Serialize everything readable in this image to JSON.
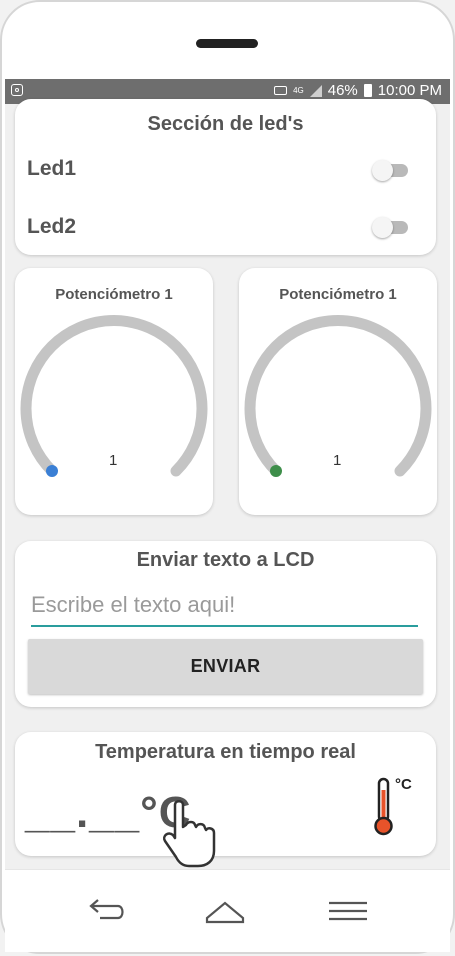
{
  "status_bar": {
    "network": "4G",
    "battery": "46%",
    "time": "10:00 PM"
  },
  "led_section": {
    "title": "Sección de led's",
    "leds": [
      {
        "label": "Led1",
        "on": false
      },
      {
        "label": "Led2",
        "on": false
      }
    ]
  },
  "potentiometers": [
    {
      "title": "Potenciómetro 1",
      "value": "1",
      "dot_color": "#3a7fd5"
    },
    {
      "title": "Potenciómetro 1",
      "value": "1",
      "dot_color": "#3e8e4a"
    }
  ],
  "lcd": {
    "title": "Enviar texto a LCD",
    "placeholder": "Escribe el texto aqui!",
    "button_label": "ENVIAR"
  },
  "temperature": {
    "title": "Temperatura en tiempo real",
    "value": "__.__°C",
    "icon_unit": "°C"
  },
  "colors": {
    "accent_input": "#2a9d9d",
    "arc_gray": "#c4c4c4",
    "thermometer_fill": "#e8532a"
  }
}
